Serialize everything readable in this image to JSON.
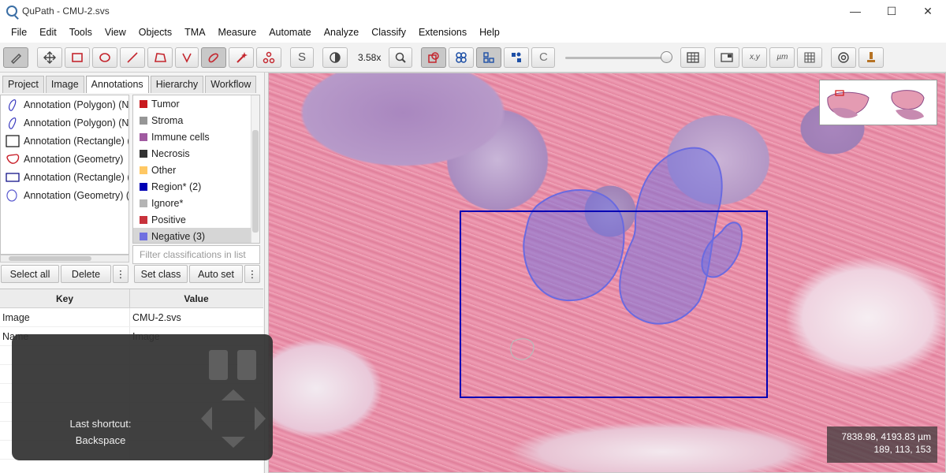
{
  "window": {
    "title": "QuPath - CMU-2.svs"
  },
  "menu": [
    "File",
    "Edit",
    "Tools",
    "View",
    "Objects",
    "TMA",
    "Measure",
    "Automate",
    "Analyze",
    "Classify",
    "Extensions",
    "Help"
  ],
  "toolbar": {
    "zoom": "3.58x",
    "icons": [
      "move-icon",
      "rectangle-icon",
      "ellipse-icon",
      "line-icon",
      "polygon-icon",
      "polyline-icon",
      "brush-icon",
      "wand-icon",
      "points-icon",
      "selection-mode-icon",
      "brightness-contrast-icon",
      "zoom-to-fit-icon",
      "show-annotations-icon",
      "show-tma-icon",
      "show-detections-icon",
      "fill-detections-icon",
      "show-classes-icon",
      "opacity-slider",
      "measurement-table-icon",
      "overview-icon",
      "location-icon",
      "scalebar-icon",
      "grid-icon",
      "preferences-icon",
      "log-icon"
    ],
    "zoom_label_icon": "magnifier-icon"
  },
  "tabs": [
    "Project",
    "Image",
    "Annotations",
    "Hierarchy",
    "Workflow"
  ],
  "active_tab": "Annotations",
  "annotations": [
    {
      "label": "Annotation (Polygon) (Ne",
      "shape": "polygon-blue"
    },
    {
      "label": "Annotation (Polygon) (Neg",
      "shape": "polygon-blue"
    },
    {
      "label": "Annotation (Rectangle) (R",
      "shape": "rect-black"
    },
    {
      "label": "Annotation (Geometry)",
      "shape": "geometry-red"
    },
    {
      "label": "Annotation (Rectangle) (R",
      "shape": "rect-navy"
    },
    {
      "label": "Annotation (Geometry) (N",
      "shape": "ellipse-blue"
    }
  ],
  "classes": [
    {
      "name": "Tumor",
      "color": "#c8191e"
    },
    {
      "name": "Stroma",
      "color": "#969696"
    },
    {
      "name": "Immune cells",
      "color": "#a05aa0"
    },
    {
      "name": "Necrosis",
      "color": "#323232"
    },
    {
      "name": "Other",
      "color": "#ffc864"
    },
    {
      "name": "Region* (2)",
      "color": "#0000b4"
    },
    {
      "name": "Ignore*",
      "color": "#b4b4b4"
    },
    {
      "name": "Positive",
      "color": "#c8323c"
    },
    {
      "name": "Negative (3)",
      "color": "#7070e0"
    }
  ],
  "selected_class": "Negative (3)",
  "filter_placeholder": "Filter classifications in list",
  "buttons": {
    "select_all": "Select all",
    "delete": "Delete",
    "more": "⋮",
    "set_class": "Set class",
    "auto_set": "Auto set"
  },
  "table": {
    "headers": [
      "Key",
      "Value"
    ],
    "rows": [
      {
        "key": "Image",
        "value": "CMU-2.svs"
      },
      {
        "key": "Name",
        "value": "Image"
      }
    ]
  },
  "overlay": {
    "line1": "Last shortcut:",
    "line2": "Backspace"
  },
  "viewer": {
    "coords_line1": "7838.98, 4193.83 µm",
    "coords_line2": "189, 113, 153",
    "region_color": "#0000b4",
    "negative_color": "#7070e0"
  }
}
